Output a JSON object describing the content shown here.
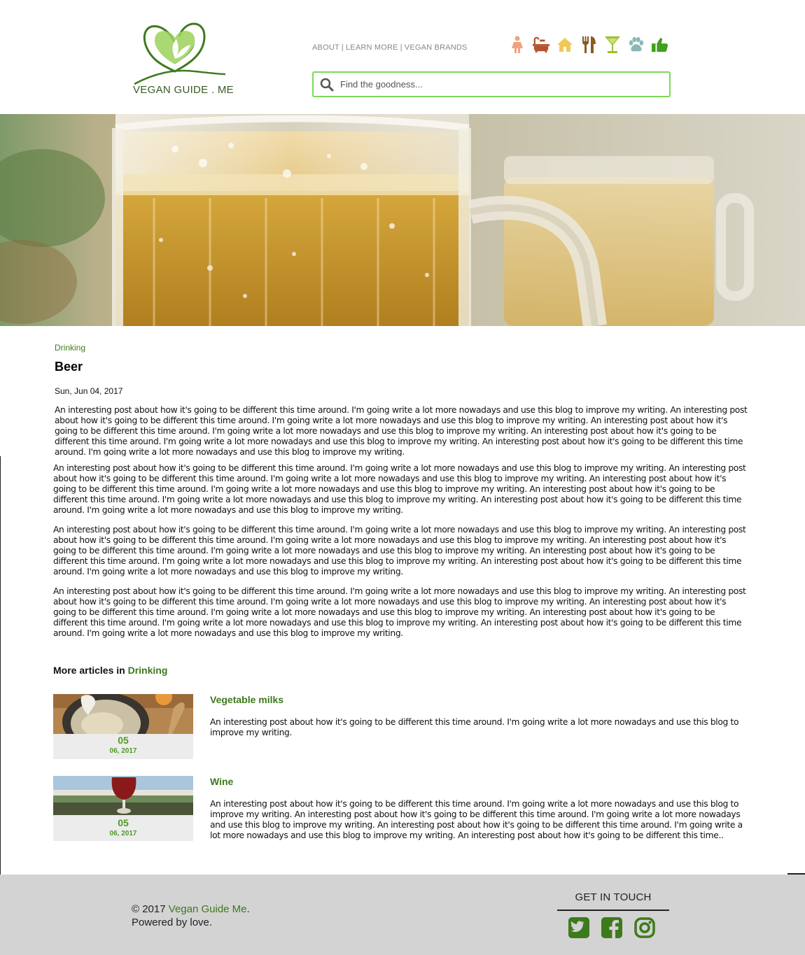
{
  "site": {
    "logo_text": "VEGAN GUIDE . ME",
    "accent_color": "#3d7a1c",
    "link_green": "#4f9a23"
  },
  "topnav": {
    "about": "ABOUT",
    "learn_more": "LEARN MORE",
    "vegan_brands": "VEGAN BRANDS",
    "separator": "|"
  },
  "category_icons": [
    {
      "name": "woman-icon",
      "color": "#f0a27e"
    },
    {
      "name": "bathtub-icon",
      "color": "#b5542e"
    },
    {
      "name": "home-icon",
      "color": "#f0c85a"
    },
    {
      "name": "fork-knife-icon",
      "color": "#8a5a24"
    },
    {
      "name": "cocktail-icon",
      "color": "#9cc02a"
    },
    {
      "name": "paw-icon",
      "color": "#8ab8b4"
    },
    {
      "name": "thumbs-up-icon",
      "color": "#3fa01c"
    }
  ],
  "search": {
    "placeholder": "Find the goodness..."
  },
  "article": {
    "category": "Drinking",
    "title": "Beer",
    "date": "Sun, Jun 04, 2017",
    "paragraphs": [
      "An interesting post about how it's going to be different this time around. I'm going write a lot more nowadays and use this blog to improve my writing. An interesting post about how it's going to be different this time around. I'm going write a lot more nowadays and use this blog to improve my writing. An interesting post about how it's going to be different this time around. I'm going write a lot more nowadays and use this blog to improve my writing. An interesting post about how it's going to be different this time around. I'm going write a lot more nowadays and use this blog to improve my writing. An interesting post about how it's going to be different this time around. I'm going write a lot more nowadays and use this blog to improve my writing.",
      "An interesting post about how it's going to be different this time around. I'm going write a lot more nowadays and use this blog to improve my writing. An interesting post about how it's going to be different this time around. I'm going write a lot more nowadays and use this blog to improve my writing. An interesting post about how it's going to be different this time around. I'm going write a lot more nowadays and use this blog to improve my writing. An interesting post about how it's going to be different this time around. I'm going write a lot more nowadays and use this blog to improve my writing. An interesting post about how it's going to be different this time around. I'm going write a lot more nowadays and use this blog to improve my writing.",
      "An interesting post about how it's going to be different this time around. I'm going write a lot more nowadays and use this blog to improve my writing. An interesting post about how it's going to be different this time around. I'm going write a lot more nowadays and use this blog to improve my writing. An interesting post about how it's going to be different this time around. I'm going write a lot more nowadays and use this blog to improve my writing. An interesting post about how it's going to be different this time around. I'm going write a lot more nowadays and use this blog to improve my writing. An interesting post about how it's going to be different this time around. I'm going write a lot more nowadays and use this blog to improve my writing.",
      "An interesting post about how it's going to be different this time around. I'm going write a lot more nowadays and use this blog to improve my writing. An interesting post about how it's going to be different this time around. I'm going write a lot more nowadays and use this blog to improve my writing. An interesting post about how it's going to be different this time around. I'm going write a lot more nowadays and use this blog to improve my writing. An interesting post about how it's going to be different this time around. I'm going write a lot more nowadays and use this blog to improve my writing. An interesting post about how it's going to be different this time around. I'm going write a lot more nowadays and use this blog to improve my writing."
    ]
  },
  "more_articles": {
    "heading": "More articles in",
    "category": "Drinking",
    "items": [
      {
        "title": "Vegetable milks",
        "day": "05",
        "month_year": "06, 2017",
        "excerpt": "An interesting post about how it's going to be different this time around. I'm going write a lot more nowadays and use this blog to improve my writing."
      },
      {
        "title": "Wine",
        "day": "05",
        "month_year": "06, 2017",
        "excerpt": "An interesting post about how it's going to be different this time around. I'm going write a lot more nowadays and use this blog to improve my writing. An interesting post about how it's going to be different this time around. I'm going write a lot more nowadays and use this blog to improve my writing. An interesting post about how it's going to be different this time around. I'm going write a lot more nowadays and use this blog to improve my writing. An interesting post about how it's going to be different this time.."
      }
    ]
  },
  "footer": {
    "copyright_prefix": "© 2017",
    "brand": "Vegan Guide Me",
    "period": ".",
    "tagline": "Powered by love.",
    "get_in_touch": "GET IN TOUCH",
    "social_icons": [
      "twitter-icon",
      "facebook-icon",
      "instagram-icon"
    ]
  }
}
